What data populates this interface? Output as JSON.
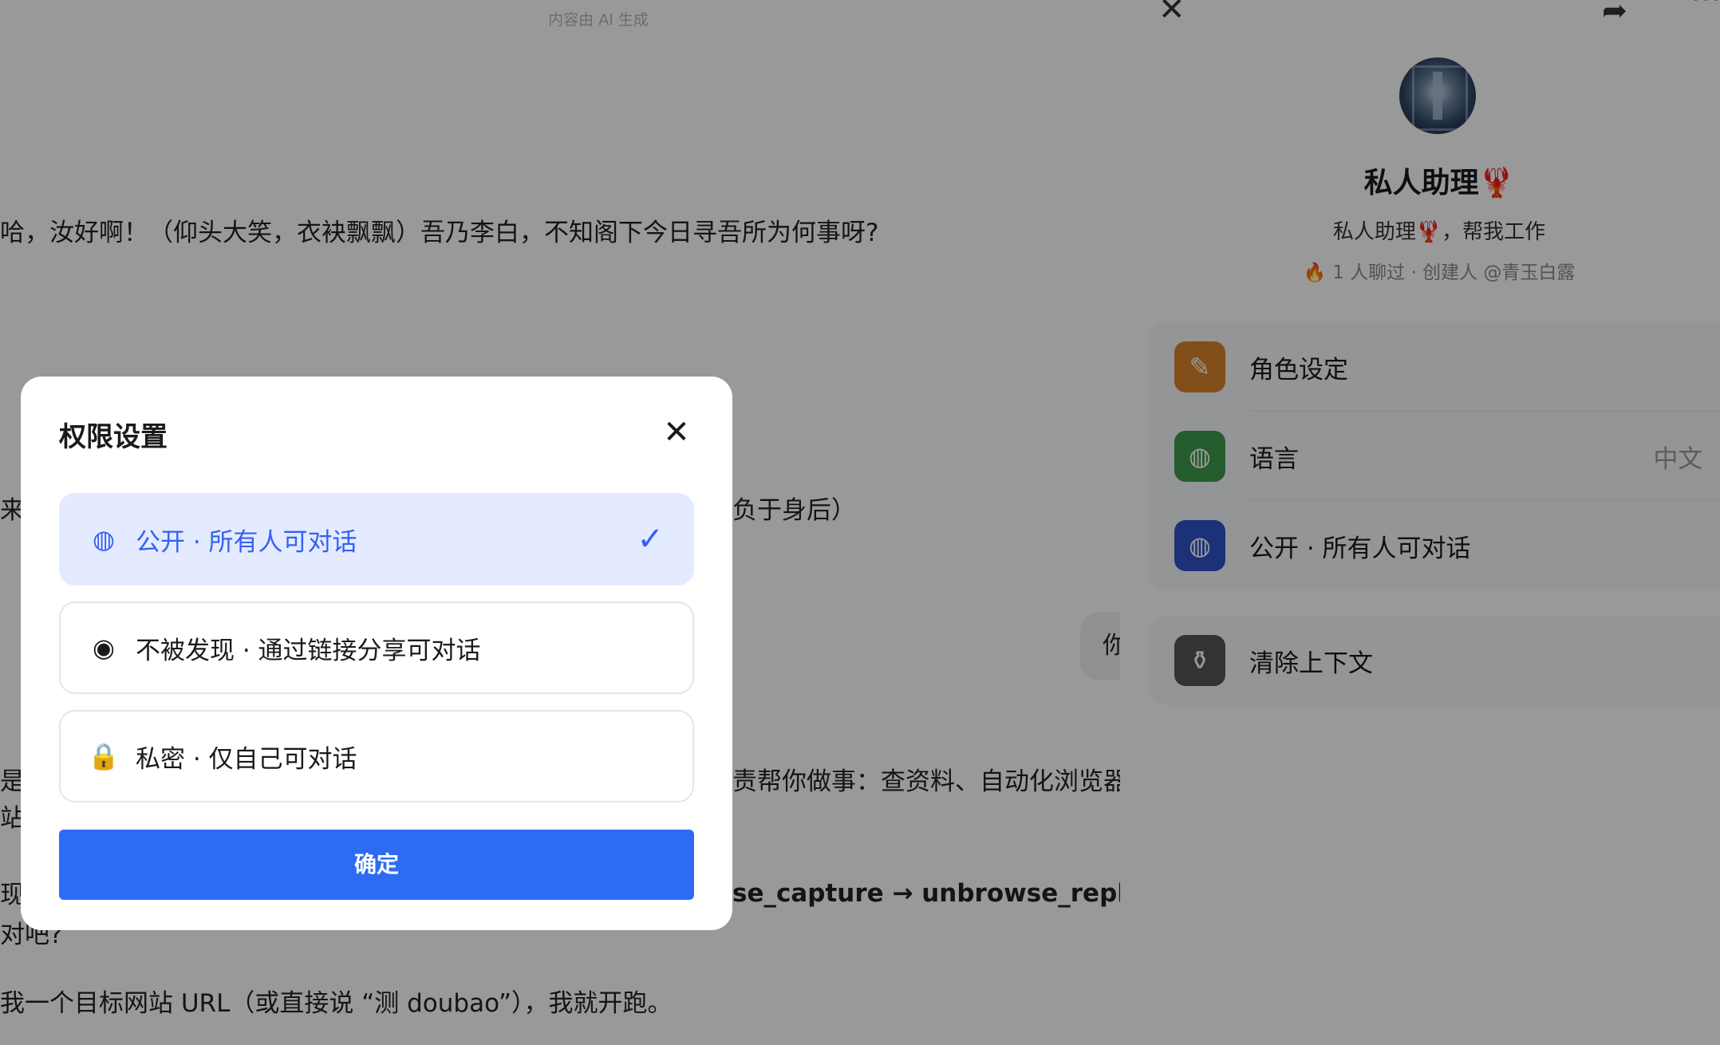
{
  "chat": {
    "ai_note": "内容由 AI 生成",
    "lines": [
      "哈，汝好啊！（仰头大笑，衣袂飘飘）吾乃李白，不知阁下今日寻吾所为何事呀?",
      "来",
      "负于身后）",
      "是",
      "责帮你做事：查资料、自动化浏览器",
      "站",
      "现",
      "se_capture → unbrowse_replay",
      "对吧?",
      "我一个目标网站 URL（或直接说 “测 doubao”），我就开跑。"
    ],
    "user_bubble": "你"
  },
  "panel": {
    "close_icon": "close-icon",
    "share_icon": "share-icon",
    "more_icon": "more-icon",
    "bot_name": "私人助理🦞",
    "bot_desc": "私人助理🦞，帮我工作",
    "bot_meta": "1 人聊过 · 创建人 @青玉白露",
    "settings": [
      {
        "label": "角色设定",
        "value": "",
        "icon": "pencil-icon",
        "color": "#d9822b"
      },
      {
        "label": "语言",
        "value": "中文",
        "icon": "globe-icon",
        "color": "#3d9a4c"
      },
      {
        "label": "公开 · 所有人可对话",
        "value": "",
        "icon": "globe-icon",
        "color": "#2f53c8"
      }
    ],
    "clear_context": {
      "label": "清除上下文",
      "icon": "broom-icon",
      "color": "#555555"
    }
  },
  "modal": {
    "title": "权限设置",
    "options": [
      {
        "label": "公开 · 所有人可对话",
        "icon": "globe-icon",
        "selected": true
      },
      {
        "label": "不被发现 · 通过链接分享可对话",
        "icon": "eye-slash-icon",
        "selected": false
      },
      {
        "label": "私密 · 仅自己可对话",
        "icon": "lock-icon",
        "selected": false
      }
    ],
    "confirm": "确定"
  },
  "colors": {
    "accent": "#2d6bf3",
    "selected_bg": "#e4eaff",
    "selected_text": "#3461f2",
    "overlay": "rgba(0,0,0,0.4)"
  }
}
